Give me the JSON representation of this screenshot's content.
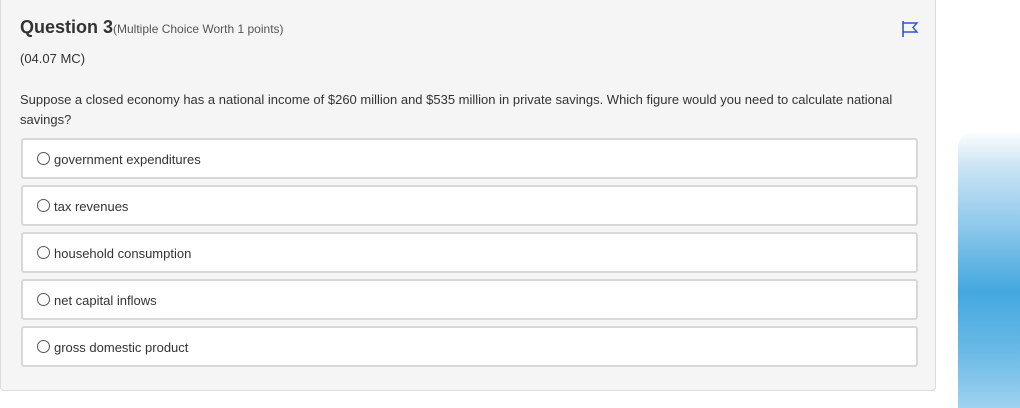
{
  "question": {
    "title": "Question 3",
    "meta": "(Multiple Choice Worth 1 points)",
    "code": "(04.07 MC)",
    "text": "Suppose a closed economy has a national income of $260 million and $535 million in private savings. Which figure would you need to calculate national savings?",
    "flag_icon": "flag-icon",
    "accent_color": "#2e56c7"
  },
  "options": [
    {
      "label": "government expenditures",
      "selected": false
    },
    {
      "label": "tax revenues",
      "selected": false
    },
    {
      "label": "household consumption",
      "selected": false
    },
    {
      "label": "net capital inflows",
      "selected": false
    },
    {
      "label": "gross domestic product",
      "selected": false
    }
  ]
}
